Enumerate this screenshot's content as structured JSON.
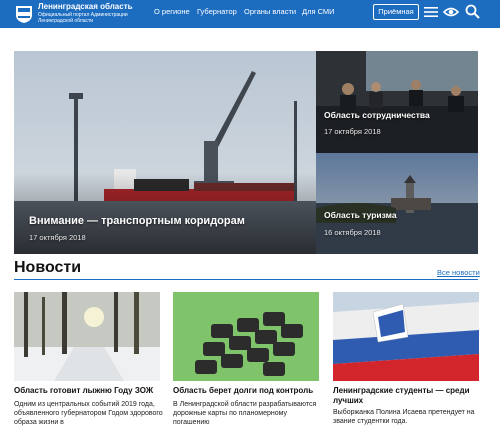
{
  "header": {
    "site_title": "Ленинградская область",
    "site_subtitle": "Официальный портал Администрации Ленинградской области",
    "nav": [
      "О регионе",
      "Губернатор",
      "Органы власти",
      "Для СМИ"
    ],
    "reception_label": "Приёмная",
    "icons": [
      "emblem-icon",
      "menu-icon",
      "eye-icon",
      "search-icon"
    ]
  },
  "hero": {
    "main": {
      "title": "Внимание — транспортным коридорам",
      "date": "17 октября 2018"
    },
    "side": [
      {
        "title": "Область сотрудничества",
        "date": "17 октября 2018"
      },
      {
        "title": "Область туризма",
        "date": "16 октября 2018"
      }
    ]
  },
  "news": {
    "heading": "Новости",
    "all_link": "Все новости",
    "cards": [
      {
        "title": "Область готовит лыжню Году ЗОЖ",
        "text": "Одним из центральных событий 2019 года, объявленного губернатором Годом здорового образа жизни в"
      },
      {
        "title": "Область берет долги под контроль",
        "text": "В Ленинградской области разрабатываются дорожные карты по планомерному погашению"
      },
      {
        "title": "Ленинградские студенты — среди лучших",
        "text": "Выборжанка Полина Исаева претендует на звание студентки года."
      }
    ]
  },
  "colors": {
    "brand_blue": "#1c6cc0"
  }
}
